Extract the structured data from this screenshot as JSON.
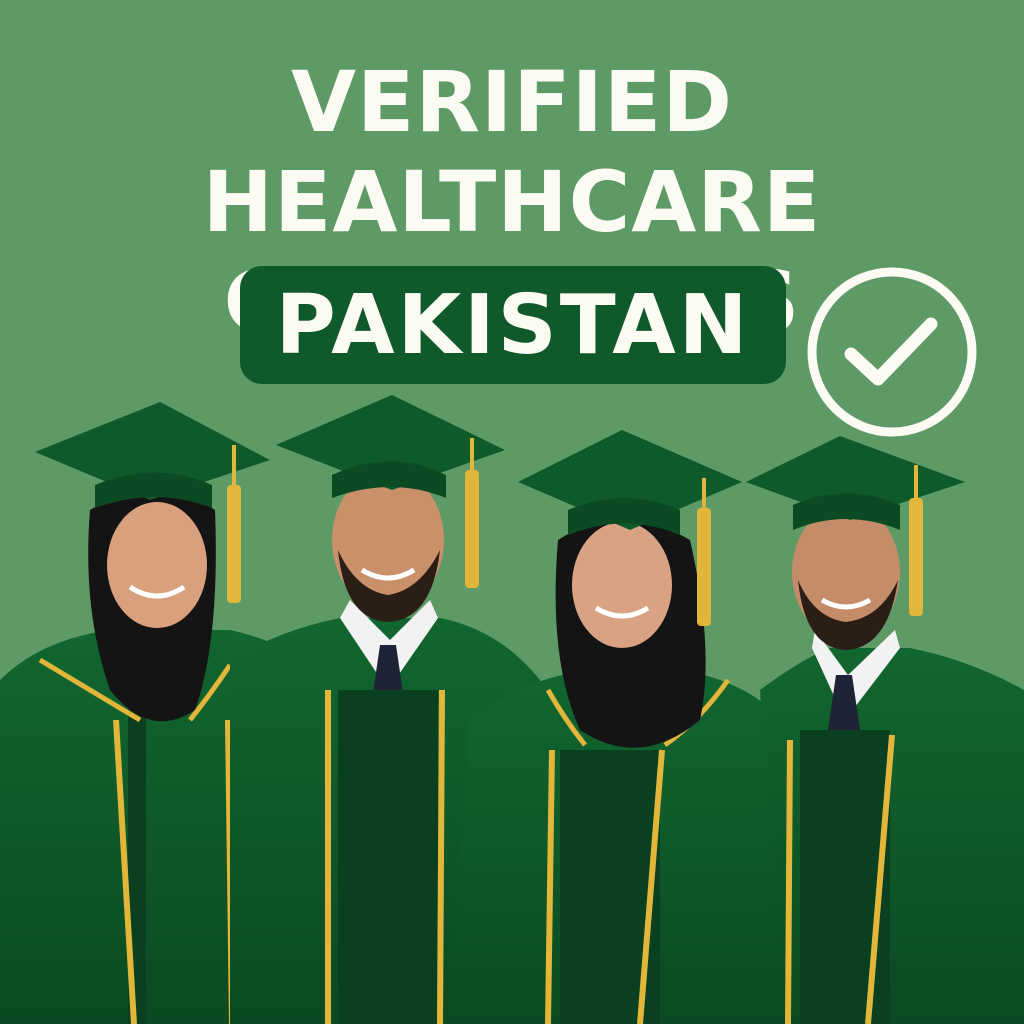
{
  "headline": {
    "line1": "VERIFIED HEALTHCARE",
    "line2": "GRADUATES"
  },
  "badge": {
    "label": "PAKISTAN"
  },
  "icons": [
    "check-circle-icon"
  ],
  "colors": {
    "background": "#5e9a66",
    "badge": "#10592a",
    "text": "#fbfaf3",
    "gown": "#0f5a2a",
    "trim": "#e2b63a",
    "hijab": "#141414"
  },
  "graduates": [
    {
      "type": "hijab"
    },
    {
      "type": "tie"
    },
    {
      "type": "hijab"
    },
    {
      "type": "tie"
    }
  ]
}
